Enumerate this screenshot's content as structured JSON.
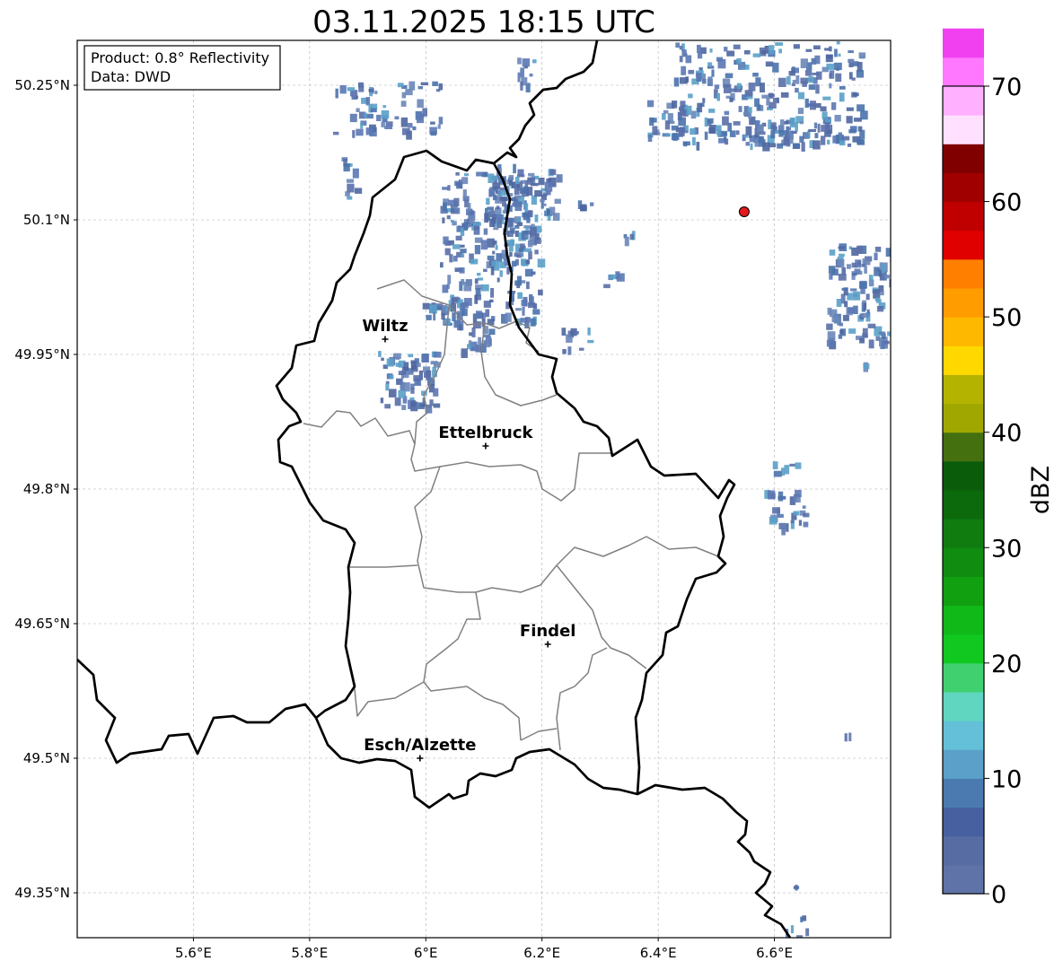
{
  "map": {
    "title": "03.11.2025 18:15 UTC",
    "info_box": {
      "product": "Product: 0.8° Reflectivity",
      "data": "Data: DWD"
    },
    "lon_range": [
      5.4,
      6.8
    ],
    "lat_range": [
      49.3,
      50.3
    ],
    "grid": true,
    "x_ticks": [
      {
        "value": 5.6,
        "label": "5.6°E"
      },
      {
        "value": 5.8,
        "label": "5.8°E"
      },
      {
        "value": 6.0,
        "label": "6°E"
      },
      {
        "value": 6.2,
        "label": "6.2°E"
      },
      {
        "value": 6.4,
        "label": "6.4°E"
      },
      {
        "value": 6.6,
        "label": "6.6°E"
      }
    ],
    "y_ticks": [
      {
        "value": 50.25,
        "label": "50.25°N"
      },
      {
        "value": 50.1,
        "label": "50.1°N"
      },
      {
        "value": 49.95,
        "label": "49.95°N"
      },
      {
        "value": 49.8,
        "label": "49.8°N"
      },
      {
        "value": 49.65,
        "label": "49.65°N"
      },
      {
        "value": 49.5,
        "label": "49.5°N"
      },
      {
        "value": 49.35,
        "label": "49.35°N"
      }
    ],
    "cities": [
      {
        "name": "Wiltz",
        "lon": 5.93,
        "lat": 49.967
      },
      {
        "name": "Ettelbruck",
        "lon": 6.103,
        "lat": 49.848
      },
      {
        "name": "Findel",
        "lon": 6.21,
        "lat": 49.627
      },
      {
        "name": "Esch/Alzette",
        "lon": 5.99,
        "lat": 49.5
      }
    ],
    "radar_site": {
      "lon": 6.548,
      "lat": 50.109,
      "color": "#e31a1c"
    }
  },
  "colorbar": {
    "label": "dBZ",
    "min": 0,
    "max": 70,
    "step": 2.5,
    "ticks": [
      "0",
      "10",
      "20",
      "30",
      "40",
      "50",
      "60",
      "70"
    ],
    "colors": [
      "#6073a8",
      "#566ca3",
      "#4760a0",
      "#4a7ab0",
      "#5aa0c8",
      "#64c0d8",
      "#60d6c0",
      "#40d070",
      "#10c820",
      "#10b818",
      "#10a010",
      "#108c10",
      "#107c10",
      "#0c6a0c",
      "#0a5c0a",
      "#447010",
      "#a0a800",
      "#b4b400",
      "#ffd800",
      "#ffb800",
      "#ff9c00",
      "#ff8000",
      "#e00000",
      "#c00000",
      "#a00000",
      "#800000",
      "#ffe0ff",
      "#ffb0ff",
      "#ff78ff",
      "#f040f0"
    ]
  }
}
